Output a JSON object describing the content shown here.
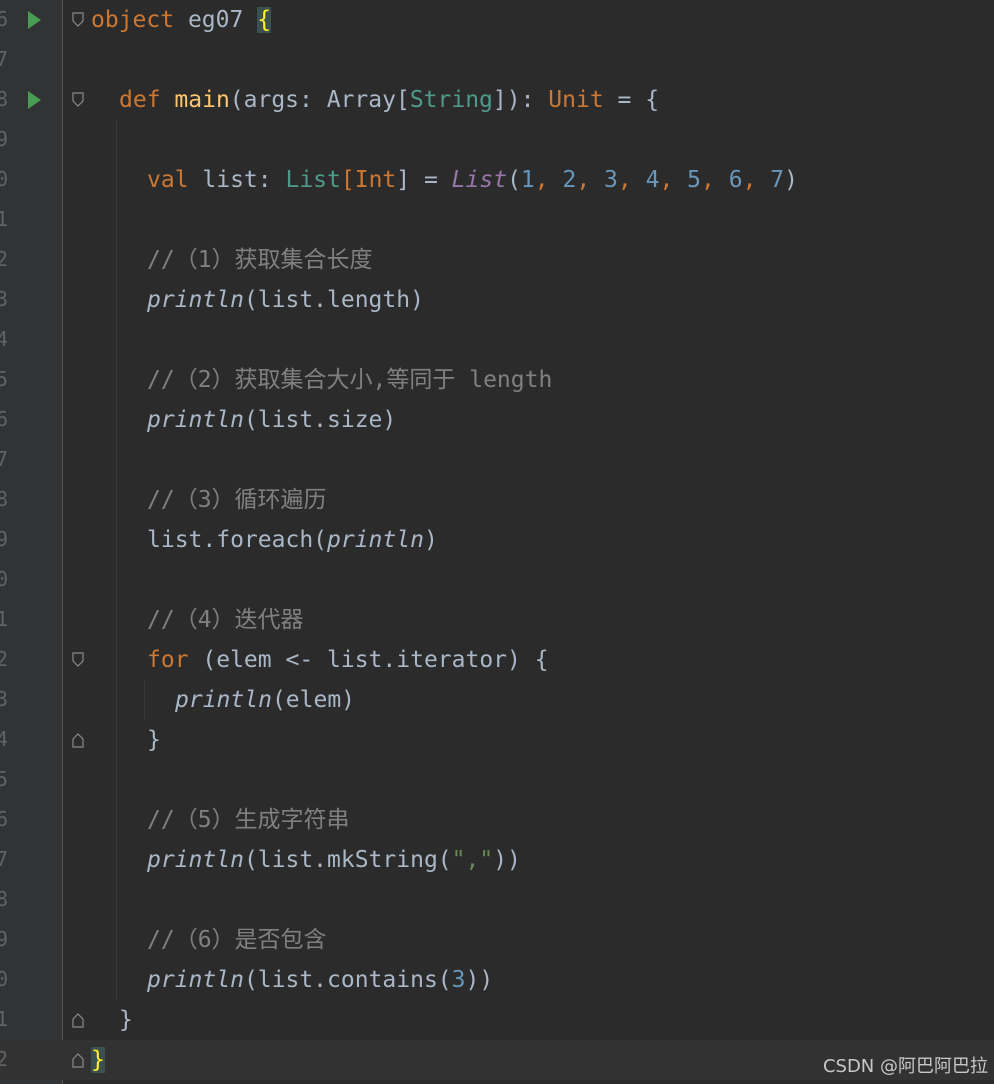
{
  "gutter": {
    "line_numbers": [
      "6",
      "7",
      "8",
      "9",
      "0",
      "1",
      "2",
      "3",
      "4",
      "5",
      "6",
      "7",
      "8",
      "9",
      "0",
      "1",
      "2",
      "3",
      "4",
      "5",
      "6",
      "7",
      "8",
      "9",
      "0",
      "1",
      "2"
    ]
  },
  "code": {
    "l1": {
      "kw": "object",
      "name": " eg07 ",
      "brace": "{"
    },
    "l3": {
      "kw": "def",
      "fn": "main",
      "p1": "(args: Array[",
      "t": "String",
      "p2": "]): ",
      "ret": "Unit",
      "p3": " = {"
    },
    "l5": {
      "kw": "val",
      "p1": " list: ",
      "t1": "List",
      "p2": "[",
      "t2": "Int",
      "p3": "] = ",
      "call": "List",
      "p4": "(",
      "n1": "1",
      "c1": ", ",
      "n2": "2",
      "c2": ", ",
      "n3": "3",
      "c3": ", ",
      "n4": "4",
      "c4": ", ",
      "n5": "5",
      "c5": ", ",
      "n6": "6",
      "c6": ", ",
      "n7": "7",
      "p5": ")"
    },
    "l7": "//（1）获取集合长度",
    "l8": {
      "fn": "println",
      "rest": "(list.length)"
    },
    "l10": "//（2）获取集合大小,等同于 length",
    "l11": {
      "fn": "println",
      "rest": "(list.size)"
    },
    "l13": "//（3）循环遍历",
    "l14": {
      "pre": "list.foreach(",
      "fn": "println",
      "post": ")"
    },
    "l16": "//（4）迭代器",
    "l17": {
      "kw": "for",
      "rest": " (elem <- list.iterator) {"
    },
    "l18": {
      "fn": "println",
      "rest": "(elem)"
    },
    "l19": "}",
    "l21": "//（5）生成字符串",
    "l22": {
      "fn": "println",
      "pre": "(list.mkString(",
      "str": "\",\"",
      "post": "))"
    },
    "l24": "//（6）是否包含",
    "l25": {
      "fn": "println",
      "pre": "(list.contains(",
      "num": "3",
      "post": "))"
    },
    "l26": "}",
    "l27": "}"
  },
  "colors": {
    "background": "#2b2b2b",
    "keyword": "#cc7832",
    "function": "#ffc66d",
    "comment": "#808080",
    "number": "#6897bb",
    "string": "#6a8759",
    "run_icon": "#499c54"
  },
  "watermark": "CSDN @阿巴阿巴拉"
}
